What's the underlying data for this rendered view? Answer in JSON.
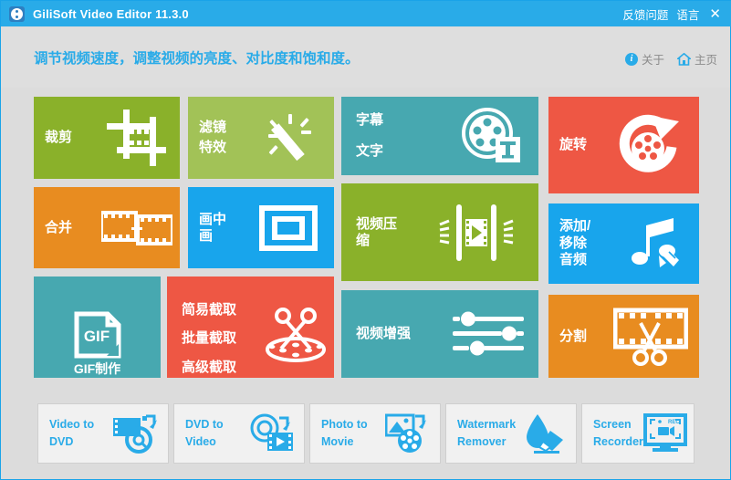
{
  "window": {
    "title": "GiliSoft Video Editor 11.3.0",
    "logo_icon": "film-reel-icon",
    "feedback_label": "反馈问题",
    "language_label": "语言",
    "close_label": "✕"
  },
  "header": {
    "subtitle": "调节视频速度，调整视频的亮度、对比度和饱和度。",
    "about_label": "关于",
    "about_icon": "info-icon",
    "home_label": "主页",
    "home_icon": "home-icon"
  },
  "colors": {
    "titlebar": "#29abe8",
    "page_bg": "#dcdcdc",
    "accent_blue": "#29abe8",
    "green_dark": "#8ab12a",
    "green_light": "#a2c257",
    "teal": "#47a8b0",
    "red": "#ee5744",
    "orange": "#e88c20",
    "blue": "#18a5ec",
    "button_bg": "#f1f1f1",
    "button_border": "#cfcfcf"
  },
  "tiles": [
    {
      "id": "crop",
      "lines": [
        "裁剪"
      ],
      "icon": "film-crop-icon",
      "color": "#8ab12a"
    },
    {
      "id": "filter",
      "lines": [
        "滤镜",
        "特效"
      ],
      "icon": "magic-wand-icon",
      "color": "#a2c257"
    },
    {
      "id": "subtitle",
      "lines": [
        "字幕",
        "文字"
      ],
      "icon": "reel-text-icon",
      "color": "#47a8b0"
    },
    {
      "id": "rotate",
      "lines": [
        "旋转"
      ],
      "icon": "rotate-reel-icon",
      "color": "#ee5744"
    },
    {
      "id": "merge",
      "lines": [
        "合并"
      ],
      "icon": "two-films-icon",
      "color": "#e88c20"
    },
    {
      "id": "pip",
      "lines": [
        "画中",
        "画"
      ],
      "icon": "frame-in-frame-icon",
      "color": "#18a5ec"
    },
    {
      "id": "compress",
      "lines": [
        "视频压",
        "缩"
      ],
      "icon": "compress-film-icon",
      "color": "#8ab12a"
    },
    {
      "id": "audio",
      "lines": [
        "添加/",
        "移除",
        "音频"
      ],
      "icon": "music-pencil-icon",
      "color": "#18a5ec"
    },
    {
      "id": "gif",
      "lines": [
        "GIF制作"
      ],
      "icon": "gif-file-icon",
      "color": "#47a8b0"
    },
    {
      "id": "cut",
      "lines": [
        "简易截取",
        "批量截取",
        "高级截取"
      ],
      "icon": "scissors-reel-icon",
      "color": "#ee5744"
    },
    {
      "id": "enhance",
      "lines": [
        "视频增强"
      ],
      "icon": "sliders-icon",
      "color": "#47a8b0"
    },
    {
      "id": "split",
      "lines": [
        "分割"
      ],
      "icon": "film-scissors-icon",
      "color": "#e88c20"
    }
  ],
  "bottom_buttons": [
    {
      "id": "video-to-dvd",
      "label": "Video to\nDVD",
      "icon": "film-disc-icon"
    },
    {
      "id": "dvd-to-video",
      "label": "DVD to\nVideo",
      "icon": "disc-film-icon"
    },
    {
      "id": "photo-to-movie",
      "label": "Photo to\nMovie",
      "icon": "photo-reel-icon"
    },
    {
      "id": "watermark-remover",
      "label": "Watermark\nRemover",
      "icon": "droplet-eraser-icon"
    },
    {
      "id": "screen-recorder",
      "label": "Screen\nRecorder",
      "icon": "monitor-rec-icon"
    }
  ]
}
